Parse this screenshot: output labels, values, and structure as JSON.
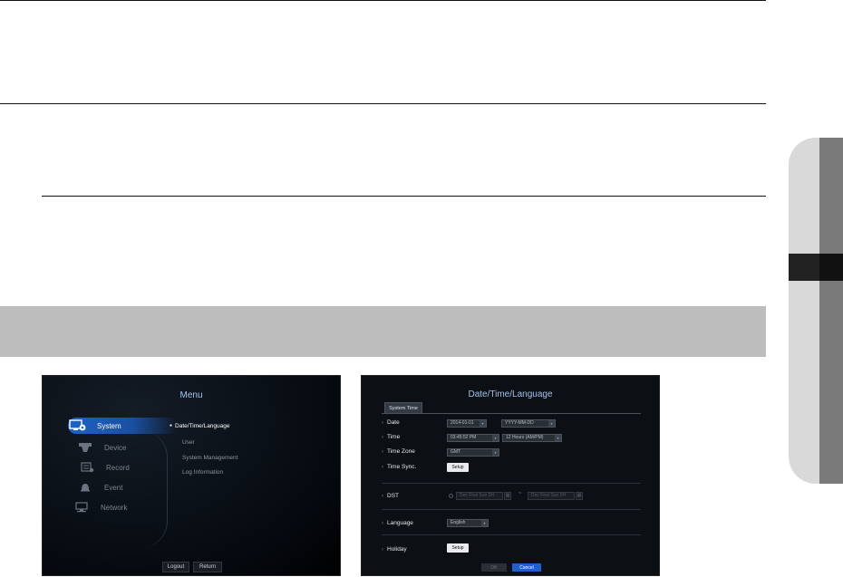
{
  "menu_screen": {
    "title": "Menu",
    "items": [
      {
        "label": "System",
        "icon": "monitor-gear-icon",
        "active": true
      },
      {
        "label": "Device",
        "icon": "camera-icon",
        "active": false
      },
      {
        "label": "Record",
        "icon": "record-icon",
        "active": false
      },
      {
        "label": "Event",
        "icon": "bell-icon",
        "active": false
      },
      {
        "label": "Network",
        "icon": "network-icon",
        "active": false
      }
    ],
    "submenu": [
      {
        "label": "Date/Time/Language",
        "selected": true
      },
      {
        "label": "User",
        "selected": false
      },
      {
        "label": "System Management",
        "selected": false
      },
      {
        "label": "Log Information",
        "selected": false
      }
    ],
    "buttons": {
      "logout": "Logout",
      "return": "Return"
    }
  },
  "dtl_screen": {
    "title": "Date/Time/Language",
    "tab": "System Time",
    "rows": {
      "date_label": "Date",
      "date_value": "2014-01-01",
      "date_format": "YYYY-MM-DD",
      "time_label": "Time",
      "time_value": "03:45:52 PM",
      "time_format": "12 Hours (AM/PM)",
      "timezone_label": "Time Zone",
      "timezone_value": "GMT",
      "timesync_label": "Time Sync.",
      "timesync_button": "Setup",
      "dst_label": "DST",
      "dst_start": "Dec First Sun 0H",
      "dst_end": "Dec First Sun 0H",
      "dst_separator": "~",
      "language_label": "Language",
      "language_value": "English",
      "holiday_label": "Holiday",
      "holiday_button": "Setup"
    },
    "buttons": {
      "ok": "OK",
      "cancel": "Cancel"
    }
  },
  "colors": {
    "accent_blue": "#1f5fd0",
    "menu_title": "#9fc4ec",
    "gray_bar": "#bdbdbd",
    "side_tab_dark": "#7a7a7a"
  }
}
